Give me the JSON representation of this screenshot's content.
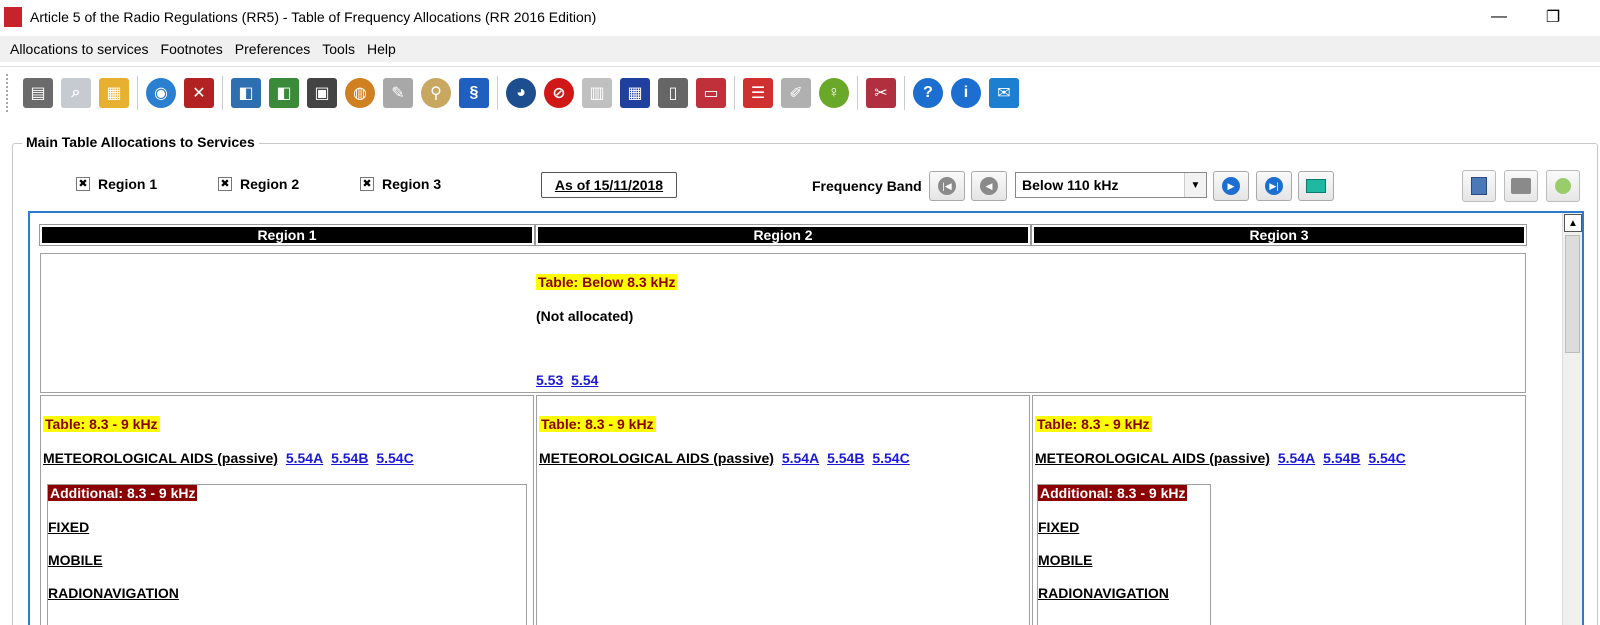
{
  "window": {
    "title": "Article 5 of the Radio Regulations (RR5) - Table of Frequency Allocations (RR 2016 Edition)",
    "minimize_glyph": "—",
    "restore_glyph": "❐"
  },
  "menubar": {
    "items": [
      "Allocations to services",
      "Footnotes",
      "Preferences",
      "Tools",
      "Help"
    ]
  },
  "toolbar": {
    "icons": [
      {
        "name": "book-icon",
        "color": "#6b6b6b"
      },
      {
        "name": "preview-icon",
        "color": "#9aa0a8"
      },
      {
        "name": "calendar-icon",
        "color": "#d8a020"
      },
      {
        "name": "globe-pin-icon",
        "color": "#2a7fd0"
      },
      {
        "name": "delete-icon",
        "color": "#b22222"
      },
      {
        "name": "dial-icon",
        "color": "#2e6fb0"
      },
      {
        "name": "dial-green-icon",
        "color": "#3a8a3a"
      },
      {
        "name": "calculator-icon",
        "color": "#444444"
      },
      {
        "name": "world-map-icon",
        "color": "#d08020"
      },
      {
        "name": "edit-icon",
        "color": "#7a7a7a"
      },
      {
        "name": "search-icon",
        "color": "#a08040"
      },
      {
        "name": "scroll-icon",
        "color": "#1e5fbf"
      },
      {
        "name": "earth-icon",
        "color": "#1d4e8f"
      },
      {
        "name": "no-entry-icon",
        "color": "#d01818"
      },
      {
        "name": "keyboard-icon",
        "color": "#b0b0b0"
      },
      {
        "name": "grid-icon",
        "color": "#2040a0"
      },
      {
        "name": "open-book-icon",
        "color": "#555555"
      },
      {
        "name": "laptop-icon",
        "color": "#c0303a"
      },
      {
        "name": "report-icon",
        "color": "#d03030"
      },
      {
        "name": "notepad-icon",
        "color": "#9a9a9a"
      },
      {
        "name": "lightbulb-icon",
        "color": "#6aa82a"
      },
      {
        "name": "tools-icon",
        "color": "#b03040"
      },
      {
        "name": "help-icon",
        "color": "#1c6fd0"
      },
      {
        "name": "info-icon",
        "color": "#1c6fd0"
      },
      {
        "name": "mail-icon",
        "color": "#1c7fd0"
      }
    ]
  },
  "group": {
    "title": "Main Table Allocations to Services"
  },
  "filters": {
    "region1": "Region 1",
    "region2": "Region 2",
    "region3": "Region 3",
    "checked_glyph": "✖",
    "as_of": "As of 15/11/2018",
    "frequency_label": "Frequency Band",
    "band_value": "Below 110 kHz"
  },
  "table": {
    "headers": [
      "Region 1",
      "Region 2",
      "Region 3"
    ],
    "row1": {
      "label": "Table:  Below 8.3 kHz",
      "note": "(Not allocated)",
      "footnotes": [
        "5.53",
        "5.54"
      ]
    },
    "row2": {
      "label": "Table:  8.3 - 9 kHz",
      "service": "METEOROLOGICAL AIDS (passive)",
      "footnotes": [
        "5.54A",
        "5.54B",
        "5.54C"
      ],
      "additional_label": "Additional:  8.3 - 9 kHz",
      "additional_services": [
        "FIXED",
        "MOBILE",
        "RADIONAVIGATION"
      ]
    }
  },
  "colors": {
    "accent_border": "#2b7bd0",
    "table_highlight": "#ffff00",
    "additional_bg": "#8b0000",
    "footnote_link": "#1a1ad6"
  }
}
